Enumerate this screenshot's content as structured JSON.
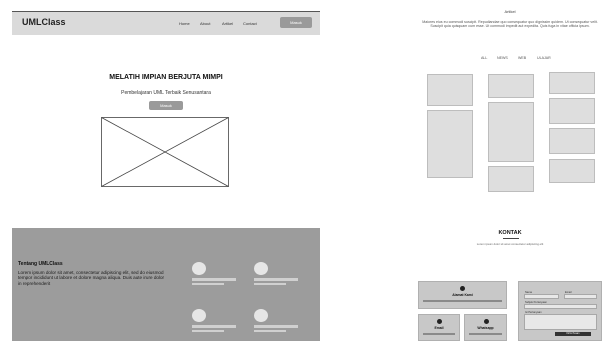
{
  "landing": {
    "navbar": {
      "brand": "UMLClass",
      "links": [
        "Home",
        "About",
        "Artikel",
        "Contact"
      ],
      "button_label": "Masuk"
    },
    "hero": {
      "title": "MELATIH IMPIAN BERJUTA MIMPI",
      "subtitle": "Pembelajaran UML  Terbaik Senusantara",
      "button_label": "Masuk",
      "image_placeholder": "image-placeholder"
    },
    "about": {
      "title": "Tentang UMLClass",
      "text": "Lorem ipsum dolor sit amet, consectetur adipiscing elit, sed do eiusmod tempor incididunt ut labore et dolore magna aliqua. Duis aute irure dolor in reprehenderit"
    }
  },
  "articles_page": {
    "header": "Artikel",
    "intro": "Maiores eius eu commodi suscipit. Repudiandae quo consequatur quo dignissim quidem. Ut consequatur velit. Suscipit quia quisquam cum esse. Ut commodi impedit aut expedita. Quis fuga in vitae officia ipsum.",
    "filters": [
      "ALL",
      "NEWS",
      "WEB",
      "ULAJAR"
    ],
    "contact": {
      "title": "KONTAK",
      "subtitle": "Lorem ipsum dolor sit amet consectetur adipiscing elit",
      "cards": [
        {
          "label": "Alamat Kami"
        },
        {
          "label": "Email"
        },
        {
          "label": "Whatsapp"
        }
      ],
      "form": {
        "name_label": "Nama",
        "email_label": "Email",
        "subject_label": "Subjek Pertanyaan",
        "message_label": "Isi Pertanyaan",
        "submit_label": "Kirim Pesan"
      }
    }
  },
  "colors": {
    "navbar_bg": "#dadada",
    "button_bg": "#9a9a9a",
    "about_bg": "#9c9c9c",
    "placeholder_box": "#dedede"
  }
}
